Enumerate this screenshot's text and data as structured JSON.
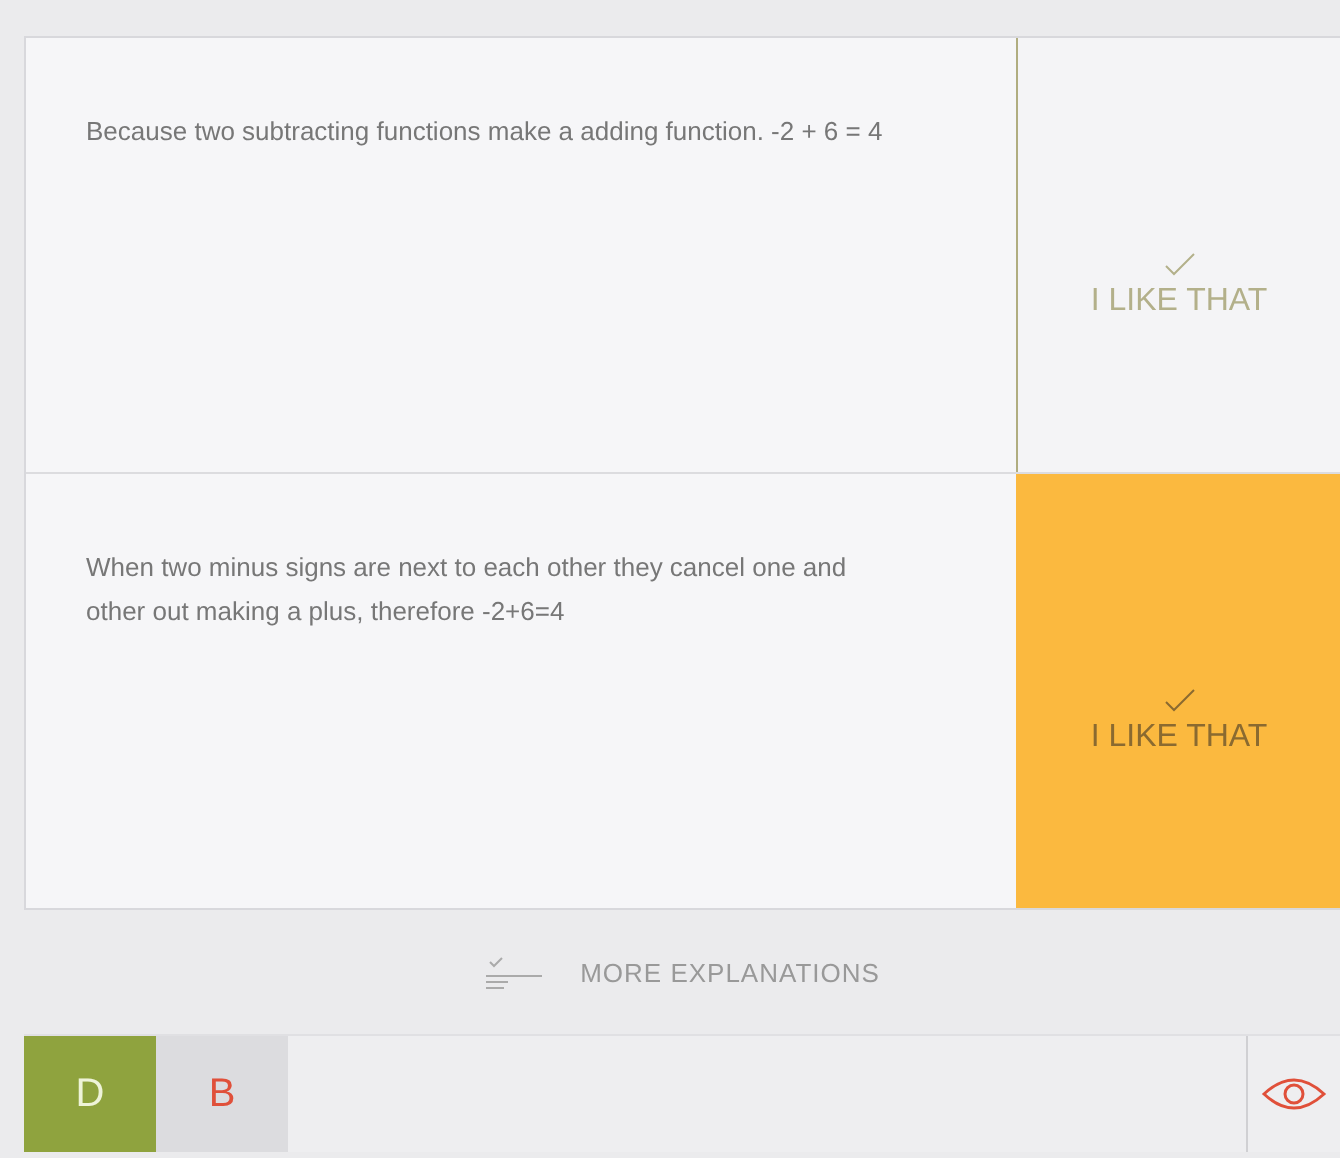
{
  "explanations": [
    {
      "text": "Because two subtracting functions make a adding function. -2 + 6 = 4",
      "like_label": "I LIKE THAT",
      "selected": false
    },
    {
      "text": "When two minus signs are next to each other they cancel one and other out making a plus, therefore -2+6=4",
      "like_label": "I LIKE THAT",
      "selected": true
    }
  ],
  "more_button": "MORE EXPLANATIONS",
  "answers": [
    {
      "label": "D",
      "kind": "correct"
    },
    {
      "label": "B",
      "kind": "wrong"
    }
  ]
}
